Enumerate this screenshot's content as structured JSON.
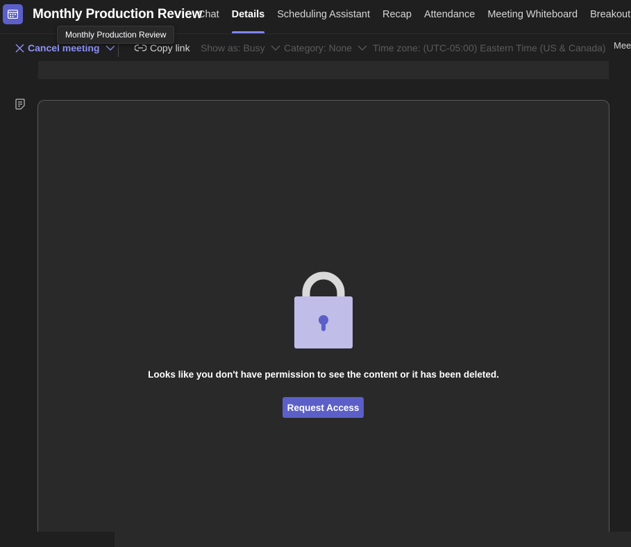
{
  "header": {
    "title": "Monthly Production Review",
    "tabs": [
      {
        "label": "Chat",
        "active": false
      },
      {
        "label": "Details",
        "active": true
      },
      {
        "label": "Scheduling Assistant",
        "active": false
      },
      {
        "label": "Recap",
        "active": false
      },
      {
        "label": "Attendance",
        "active": false
      },
      {
        "label": "Meeting Whiteboard",
        "active": false
      },
      {
        "label": "Breakout rooms",
        "active": false
      }
    ],
    "app_icon": "calendar-icon"
  },
  "tooltip": {
    "text": "Monthly Production Review"
  },
  "toolbar": {
    "cancel_label": "Cancel meeting",
    "copy_link_label": "Copy link",
    "show_as": "Show as: Busy",
    "category": "Category: None",
    "time_zone": "Time zone: (UTC-05:00) Eastern Time (US & Canada)",
    "edge_label": "Mee"
  },
  "content": {
    "message": "Looks like you don't have permission to see the content or it has been deleted.",
    "request_button": "Request Access",
    "lock_icon": "lock-icon"
  },
  "colors": {
    "accent": "#5b5fc7",
    "link": "#8e93f8",
    "lock_body": "#c0bde8",
    "lock_keyhole": "#5b5fc7",
    "background": "#1f1f1f"
  }
}
